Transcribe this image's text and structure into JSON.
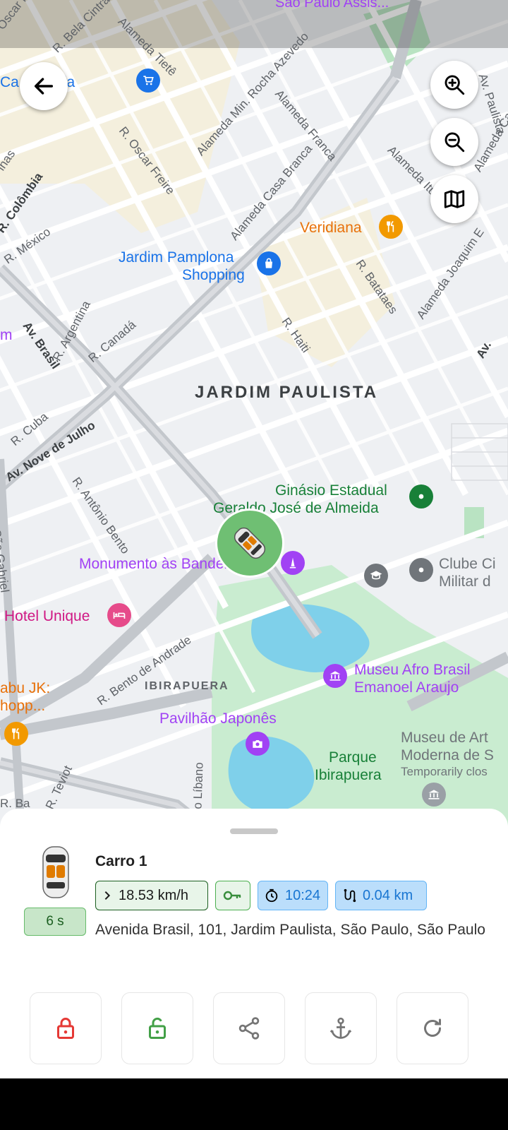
{
  "map": {
    "streets": [
      "Oscar Freire",
      "R. Bela Cintra",
      "Alameda Tietê",
      "Alameda Min. Rocha Azevedo",
      "Alameda Franca",
      "R. Oscar Freire",
      "Alameda Casa Branca",
      "Alameda Itu",
      "Av. Paulista",
      "Alameda Campinas",
      "Alameda Joaquim E",
      "R. Batataes",
      "R. Haiti",
      "Av. Brasil",
      "R. Canadá",
      "R. Argentina",
      "R. México",
      "R. Colômbia",
      "R. Cuba",
      "Av. Nove de Julho",
      "R. Antônio Bento",
      "R. Bento de Andrade",
      "R. Teviot",
      "do Líbano",
      "São Gabriel",
      "Av.",
      "lhas",
      "R. Ba",
      "m"
    ],
    "top_cut_label": "São Paulo Assis...",
    "districts": {
      "main": "JARDIM PAULISTA",
      "secondary": "IBIRAPUERA"
    },
    "pois": {
      "santa_luzia": "Ca      ta Luzia",
      "veridiana": "Veridiana",
      "jardim_pamplona_1": "Jardim Pamplona",
      "jardim_pamplona_2": "Shopping",
      "ginasio_1": "Ginásio Estadual",
      "ginasio_2": "Geraldo José de Almeida",
      "monumento": "Monumento às Bandeiras",
      "clube_1": "Clube Ci",
      "clube_2": "Militar d",
      "hotel": "Hotel Unique",
      "museu_afro_1": "Museu Afro Brasil",
      "museu_afro_2": "Emanoel Araujo",
      "pavilhao": "Pavilhão Japonês",
      "parque_1": "Parque",
      "parque_2": "Ibirapuera",
      "museu_arte_1": "Museu de Art",
      "museu_arte_2": "Moderna de S",
      "museu_arte_3": "Temporarily clos",
      "jk_1": "abu JK:",
      "jk_2": "hopp..."
    }
  },
  "controls": {
    "back_icon": "arrow-left-icon",
    "zoom_in_icon": "zoom-in-icon",
    "zoom_out_icon": "zoom-out-icon",
    "map_type_icon": "map-icon"
  },
  "vehicle": {
    "name": "Carro 1",
    "last_update": "6 s",
    "speed": "18.53 km/h",
    "ignition_icon": "key-icon",
    "time": "10:24",
    "distance": "0.04 km",
    "address": "Avenida Brasil, 101, Jardim Paulista, São Paulo, São Paulo"
  },
  "actions": [
    {
      "name": "lock",
      "icon": "lock-closed-icon",
      "color": "#e53935"
    },
    {
      "name": "unlock",
      "icon": "lock-open-icon",
      "color": "#43a047"
    },
    {
      "name": "share",
      "icon": "share-icon",
      "color": "#757575"
    },
    {
      "name": "anchor",
      "icon": "anchor-icon",
      "color": "#757575"
    },
    {
      "name": "refresh",
      "icon": "refresh-icon",
      "color": "#757575"
    }
  ],
  "colors": {
    "speed_chip_border": "#1b5e20",
    "time_chip_bg": "#c8e6c9",
    "info_chip_bg": "#bbdefb",
    "marker_bg": "#6fbf73"
  }
}
